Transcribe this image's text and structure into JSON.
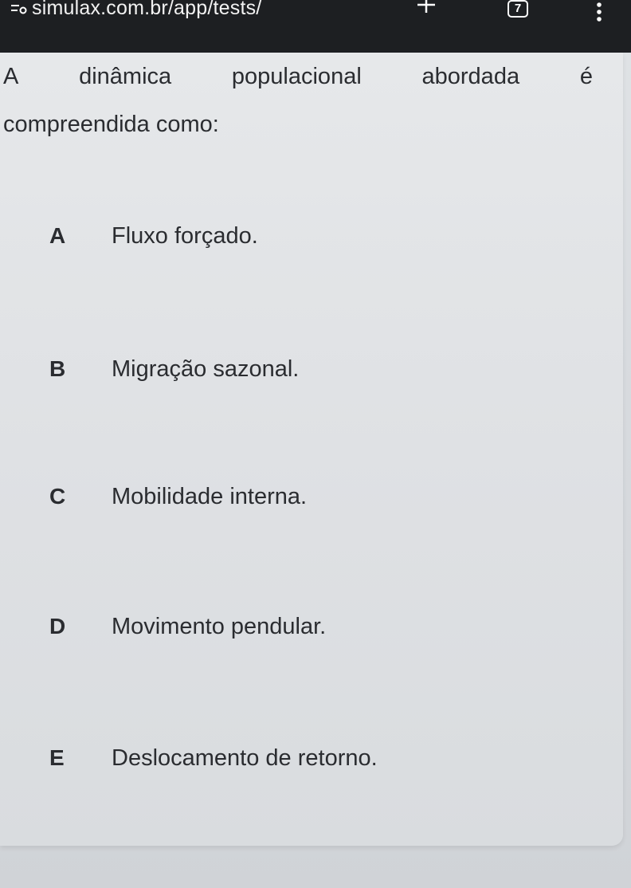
{
  "browser": {
    "url": "simulax.com.br/app/tests/",
    "tabs_count": "7",
    "icons": [
      "site-settings-icon",
      "plus-icon",
      "menu-icon"
    ]
  },
  "question": {
    "line1_words": [
      "A",
      "dinâmica",
      "populacional",
      "abordada",
      "é"
    ],
    "line2": "compreendida como:"
  },
  "options": [
    {
      "letter": "A",
      "text": "Fluxo forçado."
    },
    {
      "letter": "B",
      "text": "Migração sazonal."
    },
    {
      "letter": "C",
      "text": "Mobilidade interna."
    },
    {
      "letter": "D",
      "text": "Movimento pendular."
    },
    {
      "letter": "E",
      "text": "Deslocamento de retorno."
    }
  ]
}
